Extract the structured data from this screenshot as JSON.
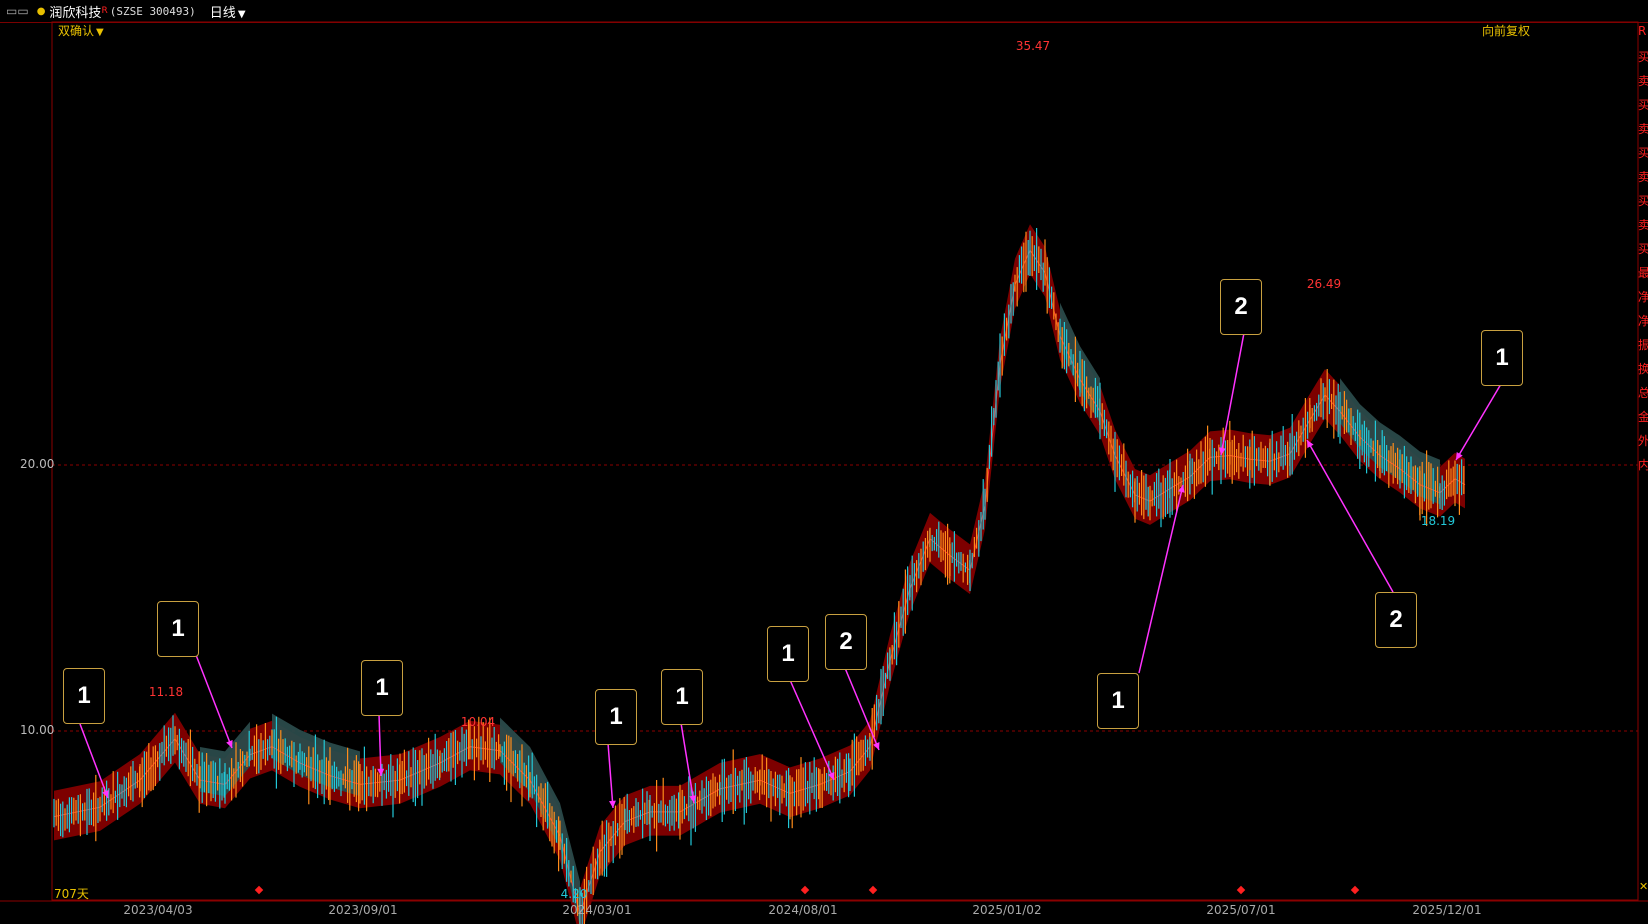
{
  "titlebar": {
    "icon": "▭▭",
    "stock_name": "润欣科技",
    "star": "R",
    "stock_code": "(SZSE 300493)",
    "period": "日线"
  },
  "indicator": {
    "name": "双确认",
    "adjust_mode": "向前复权",
    "days_label": "707天"
  },
  "colors": {
    "background": "#000000",
    "rise_candle": "#ff8c1a",
    "fall_candle": "#22c8d8",
    "band_up": "#8b0000",
    "band_down": "#2a4a4a",
    "mid_up": "#ff3030",
    "mid_down": "#30d030",
    "arrow": "#ff33ff",
    "gridline": "#8b0000",
    "accent_yellow": "#e8c000"
  },
  "chart_data": {
    "type": "candlestick",
    "ylabels": [
      "20.00",
      "10.00"
    ],
    "y_grid_values": [
      20.0,
      10.0
    ],
    "xlabels": [
      "2023/04/03",
      "2023/09/01",
      "2024/03/01",
      "2024/08/01",
      "2025/01/02",
      "2025/07/01",
      "2025/12/01"
    ],
    "peak_labels": [
      {
        "text": "11.18",
        "type": "high",
        "date": "2023/05"
      },
      {
        "text": "10.04",
        "type": "high",
        "date": "2023/12"
      },
      {
        "text": "4.20",
        "type": "low",
        "date": "2024/02"
      },
      {
        "text": "35.47",
        "type": "high",
        "date": "2025/01"
      },
      {
        "text": "26.49",
        "type": "high",
        "date": "2025/09"
      },
      {
        "text": "18.19",
        "type": "low",
        "date": "2025/12"
      }
    ],
    "signal_markers": [
      "2023/06",
      "2024/08",
      "2024/09",
      "2025/07",
      "2025/10"
    ],
    "callouts": [
      "1",
      "1",
      "1",
      "1",
      "1",
      "1",
      "2",
      "1",
      "2",
      "2",
      "1"
    ]
  },
  "right_strip": [
    "R",
    "买",
    "卖",
    "买",
    "卖",
    "买",
    "卖",
    "买",
    "卖",
    "买",
    "最",
    "净",
    "净",
    "振",
    "换",
    "总",
    "金",
    "外",
    "内"
  ]
}
